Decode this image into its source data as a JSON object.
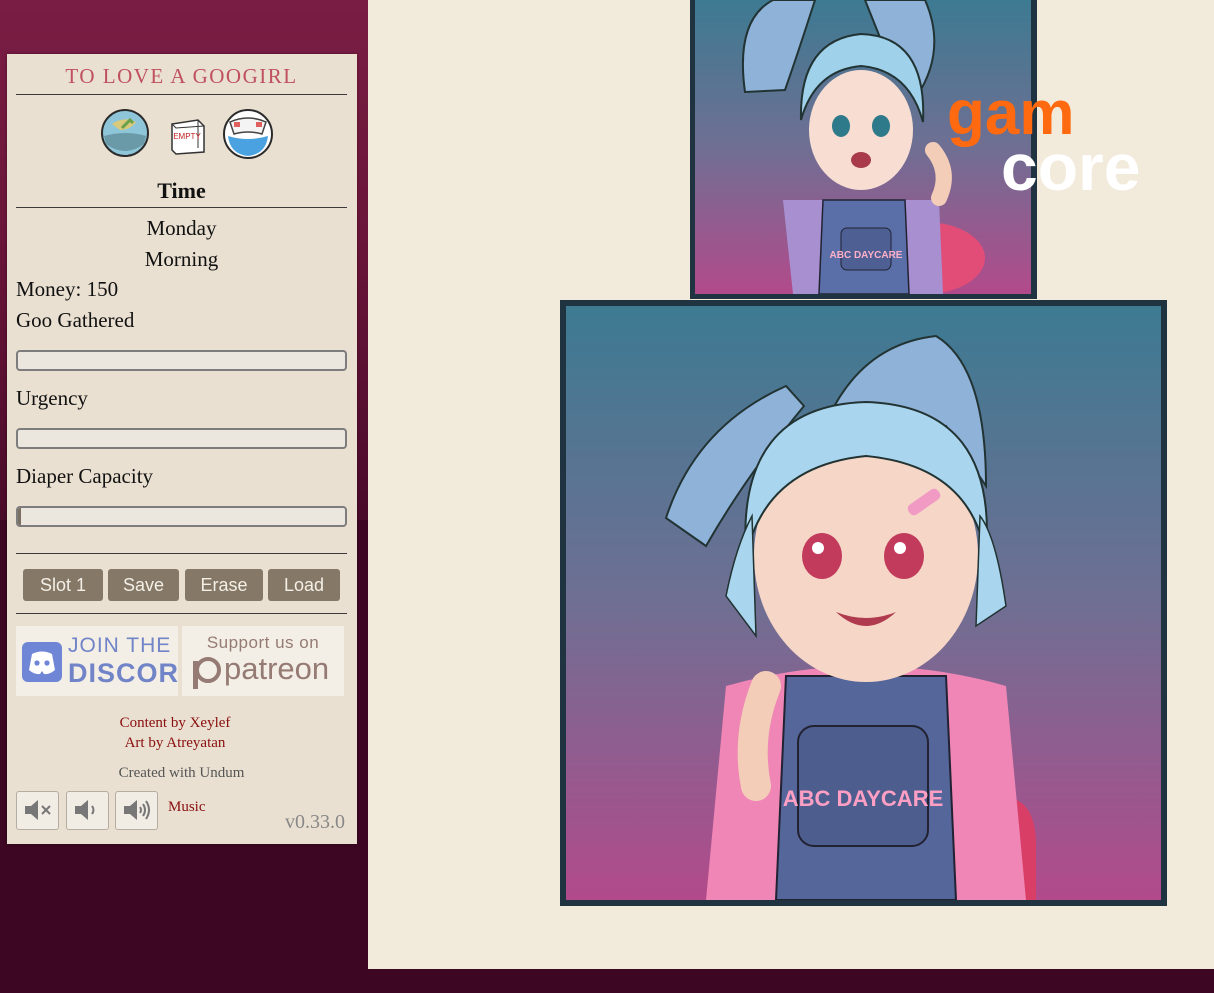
{
  "game": {
    "title": "TO LOVE A GOOGIRL"
  },
  "status_icons": [
    "goo-jar-icon",
    "empty-box-icon",
    "diaper-icon"
  ],
  "status_text": {
    "box_label": "EMPTY"
  },
  "time": {
    "heading": "Time",
    "day": "Monday",
    "period": "Morning"
  },
  "stats": {
    "money_label": "Money: 150",
    "goo_label": "Goo Gathered",
    "goo_progress": 0,
    "urgency_label": "Urgency",
    "urgency_progress": 0,
    "capacity_label": "Diaper Capacity",
    "capacity_progress": 0.01
  },
  "save_controls": {
    "slot": "Slot 1",
    "save": "Save",
    "erase": "Erase",
    "load": "Load"
  },
  "promo": {
    "discord_top": "JOIN THE",
    "discord_bottom": "DISCORD",
    "patreon_top": "Support us on",
    "patreon_bottom": "patreon"
  },
  "credits": {
    "content": "Content by Xeylef",
    "art": "Art by Atreyatan",
    "engine": "Created with Undum"
  },
  "audio": {
    "icons": [
      "mute-icon",
      "volume-low-icon",
      "volume-high-icon"
    ],
    "music_label": "Music"
  },
  "version": "v0.33.0",
  "watermark": {
    "line1": "gam",
    "line2": "core"
  },
  "art_text": {
    "top_apron": "ABC DAYCARE",
    "main_apron": "ABC DAYCARE"
  },
  "colors": {
    "accent_title": "#c05060",
    "button": "#857866",
    "sidebar": "#e9e0d1",
    "page": "#f2eada",
    "frame": "#1f3340",
    "logo_orange": "#ff6a10",
    "credits": "#8a0e0e"
  }
}
